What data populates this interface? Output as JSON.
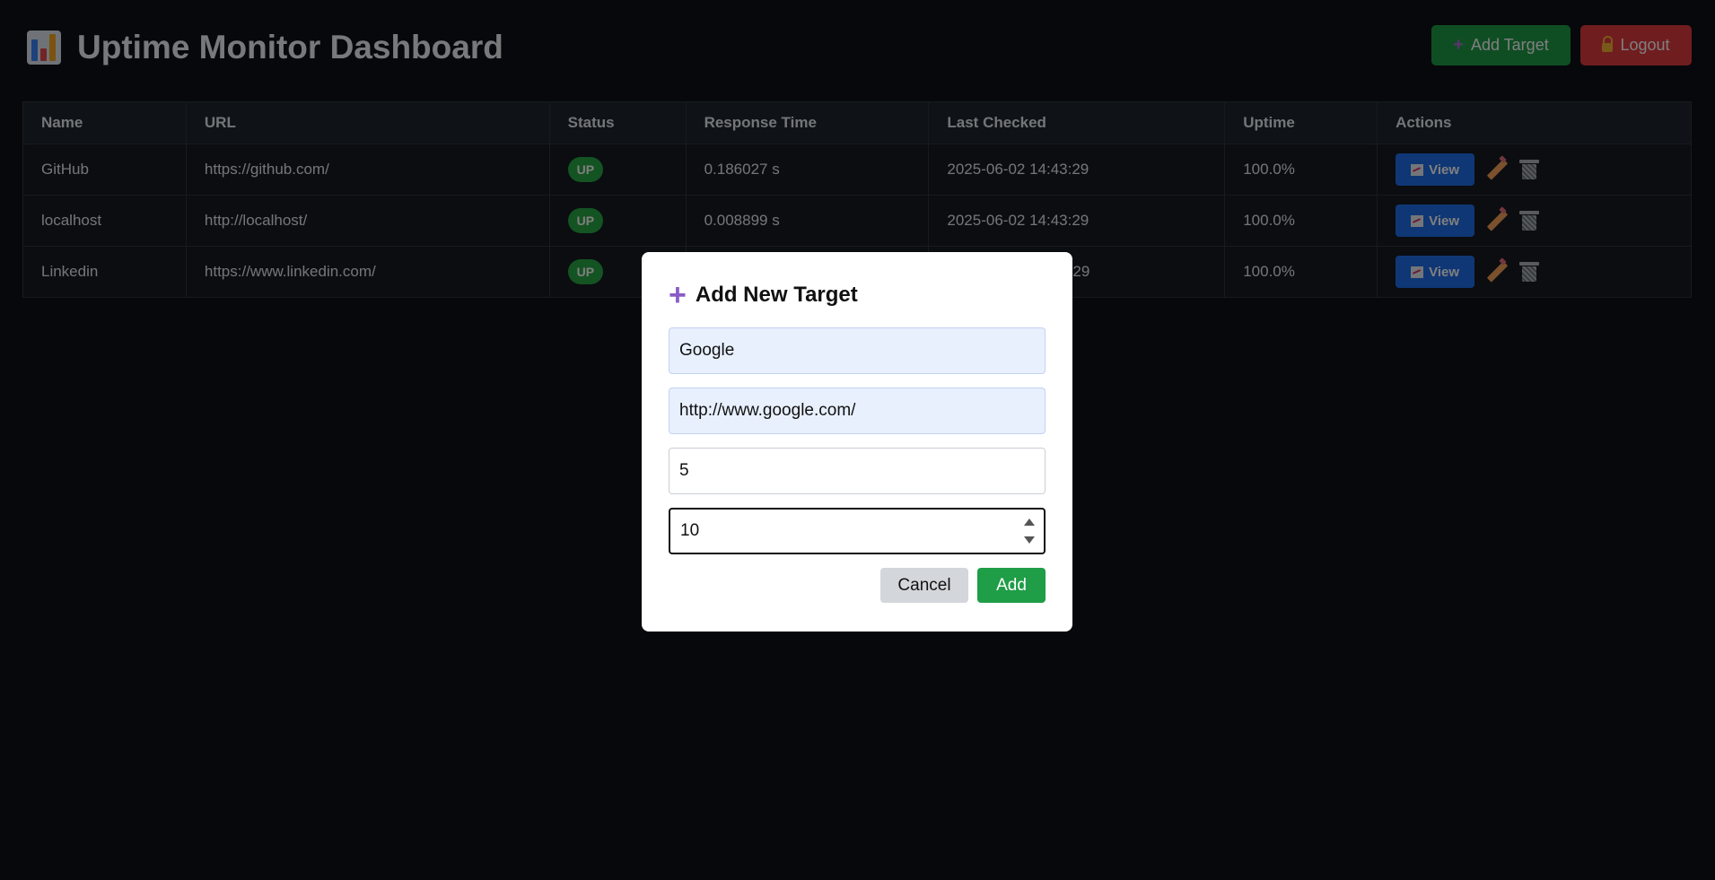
{
  "header": {
    "title": "Uptime Monitor Dashboard",
    "logo_icon": "bar-chart-icon",
    "add_target_label": "Add Target",
    "logout_label": "Logout"
  },
  "table": {
    "columns": [
      "Name",
      "URL",
      "Status",
      "Response Time",
      "Last Checked",
      "Uptime",
      "Actions"
    ],
    "rows": [
      {
        "name": "GitHub",
        "url": "https://github.com/",
        "status": "UP",
        "response_time": "0.186027 s",
        "last_checked": "2025-06-02 14:43:29",
        "uptime": "100.0%",
        "view_label": "View"
      },
      {
        "name": "localhost",
        "url": "http://localhost/",
        "status": "UP",
        "response_time": "0.008899 s",
        "last_checked": "2025-06-02 14:43:29",
        "uptime": "100.0%",
        "view_label": "View"
      },
      {
        "name": "Linkedin",
        "url": "https://www.linkedin.com/",
        "status": "UP",
        "response_time": "",
        "last_checked": "29",
        "uptime": "100.0%",
        "view_label": "View"
      }
    ]
  },
  "modal": {
    "title": "Add New Target",
    "fields": {
      "name": "Google",
      "url": "http://www.google.com/",
      "interval": "5",
      "timeout": "10"
    },
    "cancel_label": "Cancel",
    "add_label": "Add"
  },
  "colors": {
    "background": "#0d1117",
    "success": "#1f9d47",
    "danger": "#e03a3e",
    "primary": "#1f6feb",
    "status_up": "#28a745"
  }
}
